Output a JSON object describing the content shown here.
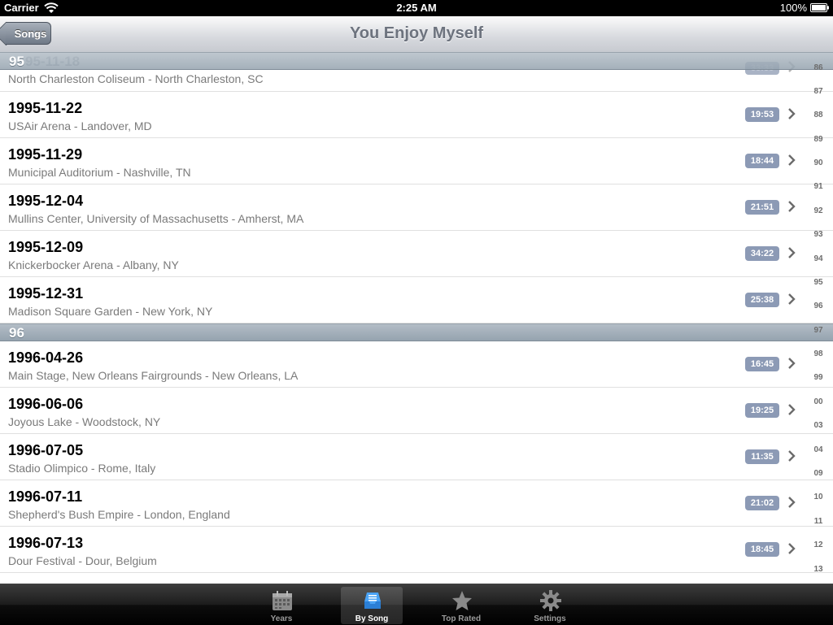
{
  "status_bar": {
    "carrier": "Carrier",
    "time": "2:25 AM",
    "battery": "100%"
  },
  "nav": {
    "back_label": "Songs",
    "title": "You Enjoy Myself"
  },
  "partial_row": {
    "section_label": "95",
    "ghost_date": "95-11-18",
    "venue": "North Charleston Coliseum - North Charleston, SC",
    "duration": "33:33"
  },
  "section_95_rows": [
    {
      "date": "1995-11-22",
      "venue": "USAir Arena - Landover, MD",
      "duration": "19:53"
    },
    {
      "date": "1995-11-29",
      "venue": "Municipal Auditorium - Nashville, TN",
      "duration": "18:44"
    },
    {
      "date": "1995-12-04",
      "venue": "Mullins Center, University of Massachusetts - Amherst, MA",
      "duration": "21:51"
    },
    {
      "date": "1995-12-09",
      "venue": "Knickerbocker Arena - Albany, NY",
      "duration": "34:22"
    },
    {
      "date": "1995-12-31",
      "venue": "Madison Square Garden - New York, NY",
      "duration": "25:38"
    }
  ],
  "section_96": {
    "label": "96"
  },
  "section_96_rows": [
    {
      "date": "1996-04-26",
      "venue": "Main Stage, New Orleans Fairgrounds - New Orleans, LA",
      "duration": "16:45"
    },
    {
      "date": "1996-06-06",
      "venue": "Joyous Lake - Woodstock, NY",
      "duration": "19:25"
    },
    {
      "date": "1996-07-05",
      "venue": "Stadio Olimpico - Rome, Italy",
      "duration": "11:35"
    },
    {
      "date": "1996-07-11",
      "venue": "Shepherd's Bush Empire - London, England",
      "duration": "21:02"
    },
    {
      "date": "1996-07-13",
      "venue": "Dour Festival - Dour, Belgium",
      "duration": "18:45"
    }
  ],
  "section_index": [
    "86",
    "87",
    "88",
    "89",
    "90",
    "91",
    "92",
    "93",
    "94",
    "95",
    "96",
    "97",
    "98",
    "99",
    "00",
    "03",
    "04",
    "09",
    "10",
    "11",
    "12",
    "13"
  ],
  "tabs": [
    {
      "label": "Years",
      "icon": "calendar-icon"
    },
    {
      "label": "By Song",
      "icon": "inbox-icon"
    },
    {
      "label": "Top Rated",
      "icon": "star-icon"
    },
    {
      "label": "Settings",
      "icon": "gear-icon"
    }
  ],
  "colors": {
    "duration_badge": "#8c9ab5",
    "section_header": "#a3afb9"
  }
}
